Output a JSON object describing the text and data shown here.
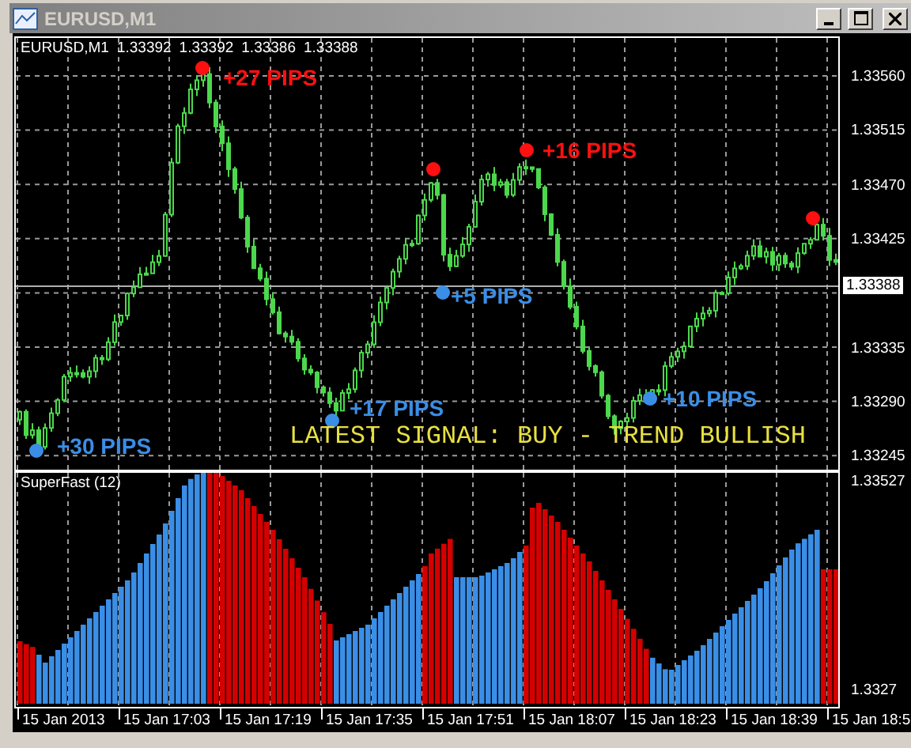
{
  "window": {
    "title": "EURUSD,M1"
  },
  "chart": {
    "symbol": "EURUSD,M1",
    "quotes": [
      "1.33392",
      "1.33392",
      "1.33386",
      "1.33388"
    ],
    "price_axis": [
      "1.33560",
      "1.33515",
      "1.33470",
      "1.33425",
      "1.33335",
      "1.33290",
      "1.33245"
    ],
    "current_price": "1.33388",
    "signals": [
      {
        "label": "+30 PIPS",
        "color": "#3a8ee6"
      },
      {
        "label": "+27 PIPS",
        "color": "#ff1010"
      },
      {
        "label": "+17 PIPS",
        "color": "#3a8ee6"
      },
      {
        "color": "#ff1010"
      },
      {
        "label": "+5 PIPS",
        "color": "#3a8ee6"
      },
      {
        "label": "+16 PIPS",
        "color": "#ff1010"
      },
      {
        "label": "+10 PIPS",
        "color": "#3a8ee6"
      },
      {
        "color": "#ff1010"
      }
    ],
    "banner": "LATEST SIGNAL: BUY - TREND BULLISH"
  },
  "indicator": {
    "name": "SuperFast (12)",
    "axis": [
      "1.33527",
      "1.3327"
    ]
  },
  "time_axis": [
    "15 Jan 2013",
    "15 Jan 17:03",
    "15 Jan 17:19",
    "15 Jan 17:35",
    "15 Jan 17:51",
    "15 Jan 18:07",
    "15 Jan 18:23",
    "15 Jan 18:39",
    "15 Jan 18:5"
  ]
}
